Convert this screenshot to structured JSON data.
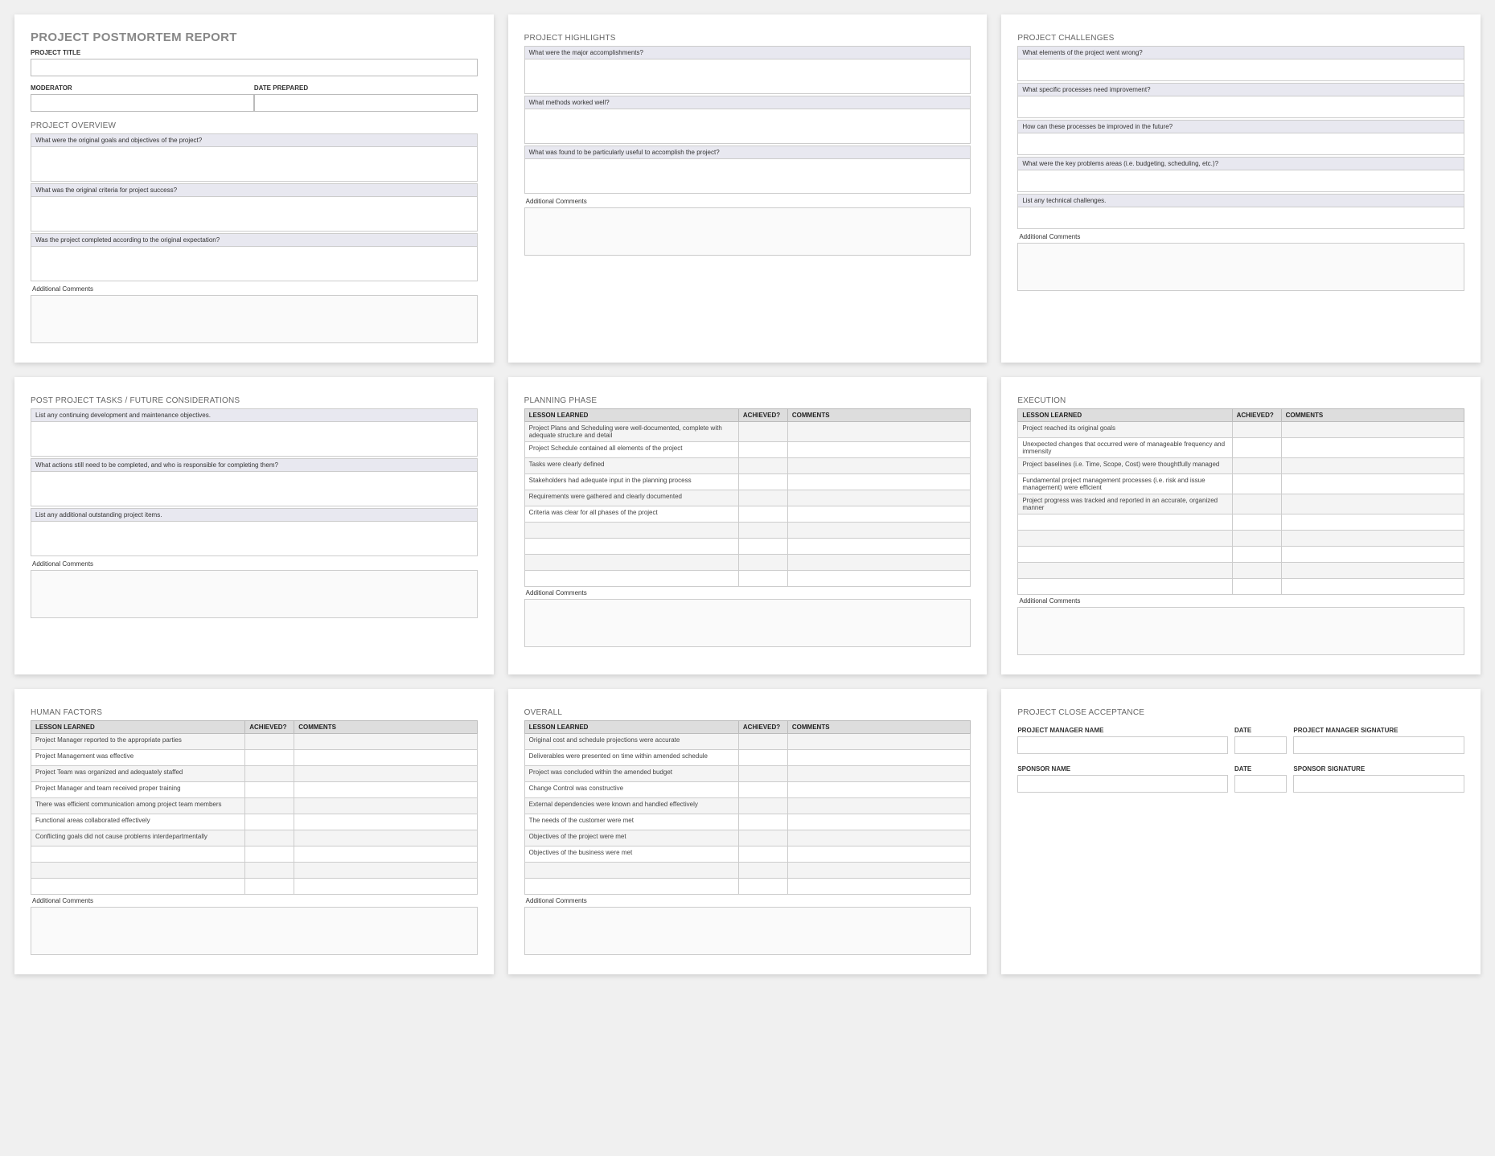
{
  "card1": {
    "title": "PROJECT POSTMORTEM REPORT",
    "project_title_label": "PROJECT TITLE",
    "moderator_label": "MODERATOR",
    "date_prepared_label": "DATE PREPARED",
    "overview_title": "PROJECT OVERVIEW",
    "q1": "What were the original goals and objectives of the project?",
    "q2": "What was the original criteria for project success?",
    "q3": "Was the project completed according to the original expectation?",
    "comments_label": "Additional Comments"
  },
  "card2": {
    "title": "PROJECT HIGHLIGHTS",
    "q1": "What were the major accomplishments?",
    "q2": "What methods worked well?",
    "q3": "What was found to be particularly useful to accomplish the project?",
    "comments_label": "Additional Comments"
  },
  "card3": {
    "title": "PROJECT CHALLENGES",
    "q1": "What elements of the project went wrong?",
    "q2": "What specific processes need improvement?",
    "q3": "How can these processes be improved in the future?",
    "q4": "What were the key problems areas (i.e. budgeting, scheduling, etc.)?",
    "q5": "List any technical challenges.",
    "comments_label": "Additional Comments"
  },
  "card4": {
    "title": "POST PROJECT TASKS / FUTURE CONSIDERATIONS",
    "q1": "List any continuing development and maintenance objectives.",
    "q2": "What actions still need to be completed, and who is responsible for completing them?",
    "q3": "List any additional outstanding project items.",
    "comments_label": "Additional Comments"
  },
  "card5": {
    "title": "PLANNING PHASE",
    "headers": {
      "lesson": "LESSON LEARNED",
      "achieved": "ACHIEVED?",
      "comments": "COMMENTS"
    },
    "rows": [
      "Project Plans and Scheduling were well-documented, complete with adequate structure and detail",
      "Project Schedule contained all elements of the project",
      "Tasks were clearly defined",
      "Stakeholders had adequate input in the planning process",
      "Requirements were gathered and clearly documented",
      "Criteria was clear for all phases of the project",
      "",
      "",
      "",
      ""
    ],
    "comments_label": "Additional Comments"
  },
  "card6": {
    "title": "EXECUTION",
    "headers": {
      "lesson": "LESSON LEARNED",
      "achieved": "ACHIEVED?",
      "comments": "COMMENTS"
    },
    "rows": [
      "Project reached its original goals",
      "Unexpected changes that occurred were of manageable frequency and immensity",
      "Project baselines (i.e. Time, Scope, Cost) were thoughtfully managed",
      "Fundamental project management processes (i.e. risk and issue management) were efficient",
      "Project progress was tracked and reported in an accurate, organized manner",
      "",
      "",
      "",
      "",
      ""
    ],
    "comments_label": "Additional Comments"
  },
  "card7": {
    "title": "HUMAN FACTORS",
    "headers": {
      "lesson": "LESSON LEARNED",
      "achieved": "ACHIEVED?",
      "comments": "COMMENTS"
    },
    "rows": [
      "Project Manager reported to the appropriate parties",
      "Project Management was effective",
      "Project Team was organized and adequately staffed",
      "Project Manager and team received proper training",
      "There was efficient communication among project team members",
      "Functional areas collaborated effectively",
      "Conflicting goals did not cause problems interdepartmentally",
      "",
      "",
      ""
    ],
    "comments_label": "Additional Comments"
  },
  "card8": {
    "title": "OVERALL",
    "headers": {
      "lesson": "LESSON LEARNED",
      "achieved": "ACHIEVED?",
      "comments": "COMMENTS"
    },
    "rows": [
      "Original cost and schedule projections were accurate",
      "Deliverables were presented on time within amended schedule",
      "Project was concluded within the amended budget",
      "Change Control was constructive",
      "External dependencies were known and handled effectively",
      "The needs of the customer were met",
      "Objectives of the project were met",
      "Objectives of the business were met",
      "",
      ""
    ],
    "comments_label": "Additional Comments"
  },
  "card9": {
    "title": "PROJECT CLOSE ACCEPTANCE",
    "pm_name": "PROJECT MANAGER NAME",
    "date": "DATE",
    "pm_sig": "PROJECT MANAGER SIGNATURE",
    "sp_name": "SPONSOR NAME",
    "sp_sig": "SPONSOR SIGNATURE"
  }
}
